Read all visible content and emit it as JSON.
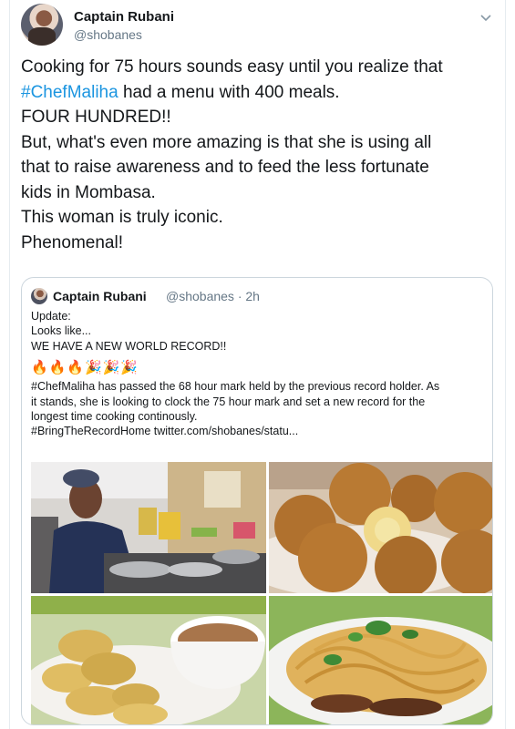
{
  "author": {
    "name": "Captain Rubani",
    "handle": "@shobanes"
  },
  "tweet_lines": [
    {
      "pre": "Cooking for 75 hours sounds easy until you realize that",
      "tag": "",
      "post": ""
    },
    {
      "pre": "",
      "tag": "#ChefMaliha",
      "post": " had a menu with 400 meals."
    },
    {
      "pre": "FOUR HUNDRED!!",
      "tag": "",
      "post": ""
    },
    {
      "pre": "But, what's even more amazing is that she is using all",
      "tag": "",
      "post": ""
    },
    {
      "pre": "that to raise awareness and to feed the less fortunate",
      "tag": "",
      "post": ""
    },
    {
      "pre": "kids in Mombasa.",
      "tag": "",
      "post": ""
    },
    {
      "pre": "This woman is truly iconic.",
      "tag": "",
      "post": ""
    },
    {
      "pre": "Phenomenal!",
      "tag": "",
      "post": ""
    }
  ],
  "quoted": {
    "name": "Captain Rubani",
    "meta": "@shobanes · 2h",
    "lines_top": [
      "Update:",
      "Looks like...",
      "WE HAVE A NEW WORLD RECORD!!"
    ],
    "emoji": "🔥🔥🔥🎉🎉🎉",
    "lines_bottom": [
      "#ChefMaliha has passed the 68 hour mark held by the previous record holder. As",
      "it stands, she is looking to clock the 75 hour mark and set a new record for the",
      "longest time cooking continously.",
      "#BringTheRecordHome twitter.com/shobanes/statu..."
    ]
  },
  "icons": {
    "caret": "chevron-down-icon"
  },
  "colors": {
    "hashtag": "#1b95e0",
    "muted": "#657786",
    "border": "#ccd6dd"
  }
}
